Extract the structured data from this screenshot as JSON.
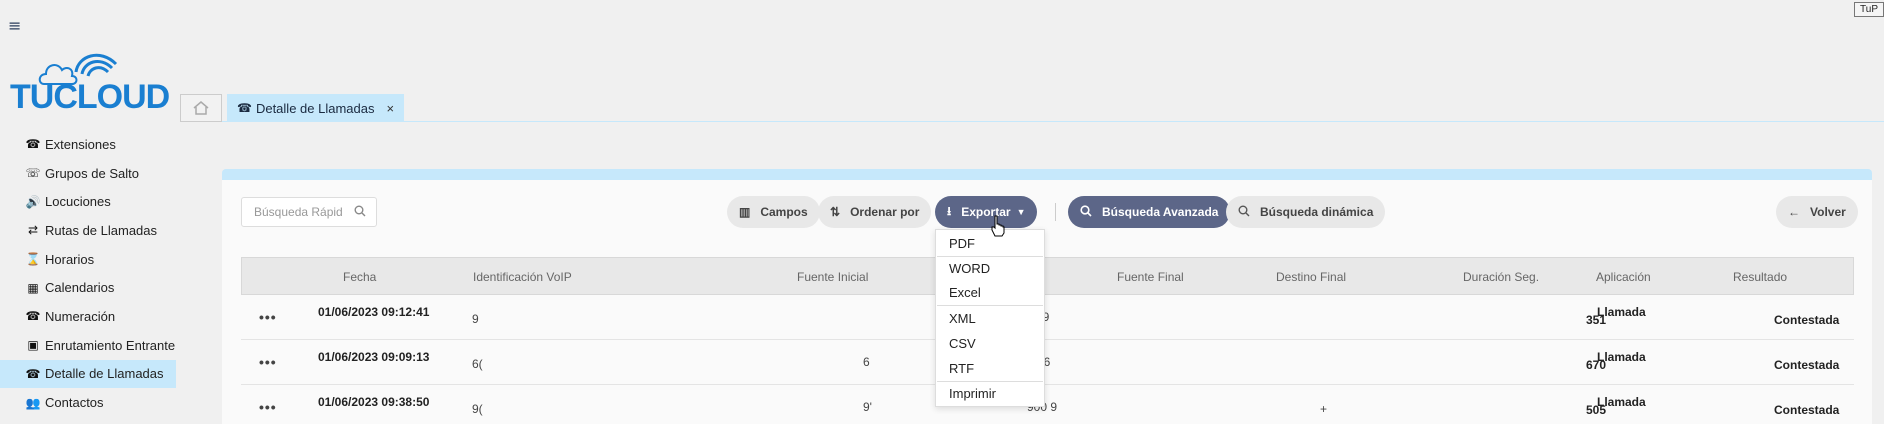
{
  "top_right_button": "TuP",
  "logo": {
    "text": "TUCLOUD"
  },
  "sidebar": {
    "items": [
      {
        "label": "Extensiones",
        "icon": "extension-icon",
        "glyph": "☎",
        "active": false
      },
      {
        "label": "Grupos de Salto",
        "icon": "group-icon",
        "glyph": "☏",
        "active": false
      },
      {
        "label": "Locuciones",
        "icon": "speaker-icon",
        "glyph": "🔊",
        "active": false
      },
      {
        "label": "Rutas de Llamadas",
        "icon": "route-icon",
        "glyph": "⇄",
        "active": false
      },
      {
        "label": "Horarios",
        "icon": "hourglass-icon",
        "glyph": "⌛",
        "active": false
      },
      {
        "label": "Calendarios",
        "icon": "calendar-icon",
        "glyph": "▦",
        "active": false
      },
      {
        "label": "Numeración",
        "icon": "numbering-icon",
        "glyph": "☎",
        "active": false
      },
      {
        "label": "Enrutamiento Entrante",
        "icon": "contact-card-icon",
        "glyph": "▣",
        "active": false
      },
      {
        "label": "Detalle de Llamadas",
        "icon": "phone-detail-icon",
        "glyph": "☎",
        "active": true
      },
      {
        "label": "Contactos",
        "icon": "users-icon",
        "glyph": "👥",
        "active": false
      }
    ]
  },
  "tabs": {
    "home_icon": "home-icon",
    "active_label": "Detalle de Llamadas",
    "close_glyph": "×"
  },
  "toolbar": {
    "search_placeholder": "Búsqueda Rápid",
    "campos": "Campos",
    "ordenar": "Ordenar por",
    "exportar": "Exportar",
    "busqueda_avanzada": "Búsqueda Avanzada",
    "busqueda_dinamica": "Búsqueda dinámica",
    "volver": "Volver"
  },
  "export_menu": [
    "PDF",
    "WORD",
    "Excel",
    "XML",
    "CSV",
    "RTF",
    "Imprimir"
  ],
  "table": {
    "columns": [
      "Fecha",
      "Identificación VoIP",
      "Fuente Inicial",
      "Fuente Final",
      "Destino Final",
      "Duración Seg.",
      "Aplicación",
      "Resultado"
    ],
    "rows": [
      {
        "fecha": "01/06/2023 09:12:41",
        "voip": "9",
        "fuente_inicial": "",
        "fuente_final": "'0!        9",
        "destino_final": "",
        "duracion": "351",
        "aplicacion": "Llamada",
        "resultado": "Contestada"
      },
      {
        "fecha": "01/06/2023 09:09:13",
        "voip": "6(",
        "fuente_inicial": "6",
        "fuente_final": "00          6",
        "destino_final": "",
        "duracion": "670",
        "aplicacion": "Llamada",
        "resultado": "Contestada"
      },
      {
        "fecha": "01/06/2023 09:38:50",
        "voip": "9(",
        "fuente_inicial": "9'",
        "fuente_final": "900        9",
        "destino_final": "+",
        "duracion": "505",
        "aplicacion": "Llamada",
        "resultado": "Contestada"
      }
    ]
  },
  "colors": {
    "accent_light": "#c6e8fb",
    "button_dark": "#5c6688",
    "logo_blue": "#1a7fd1"
  }
}
